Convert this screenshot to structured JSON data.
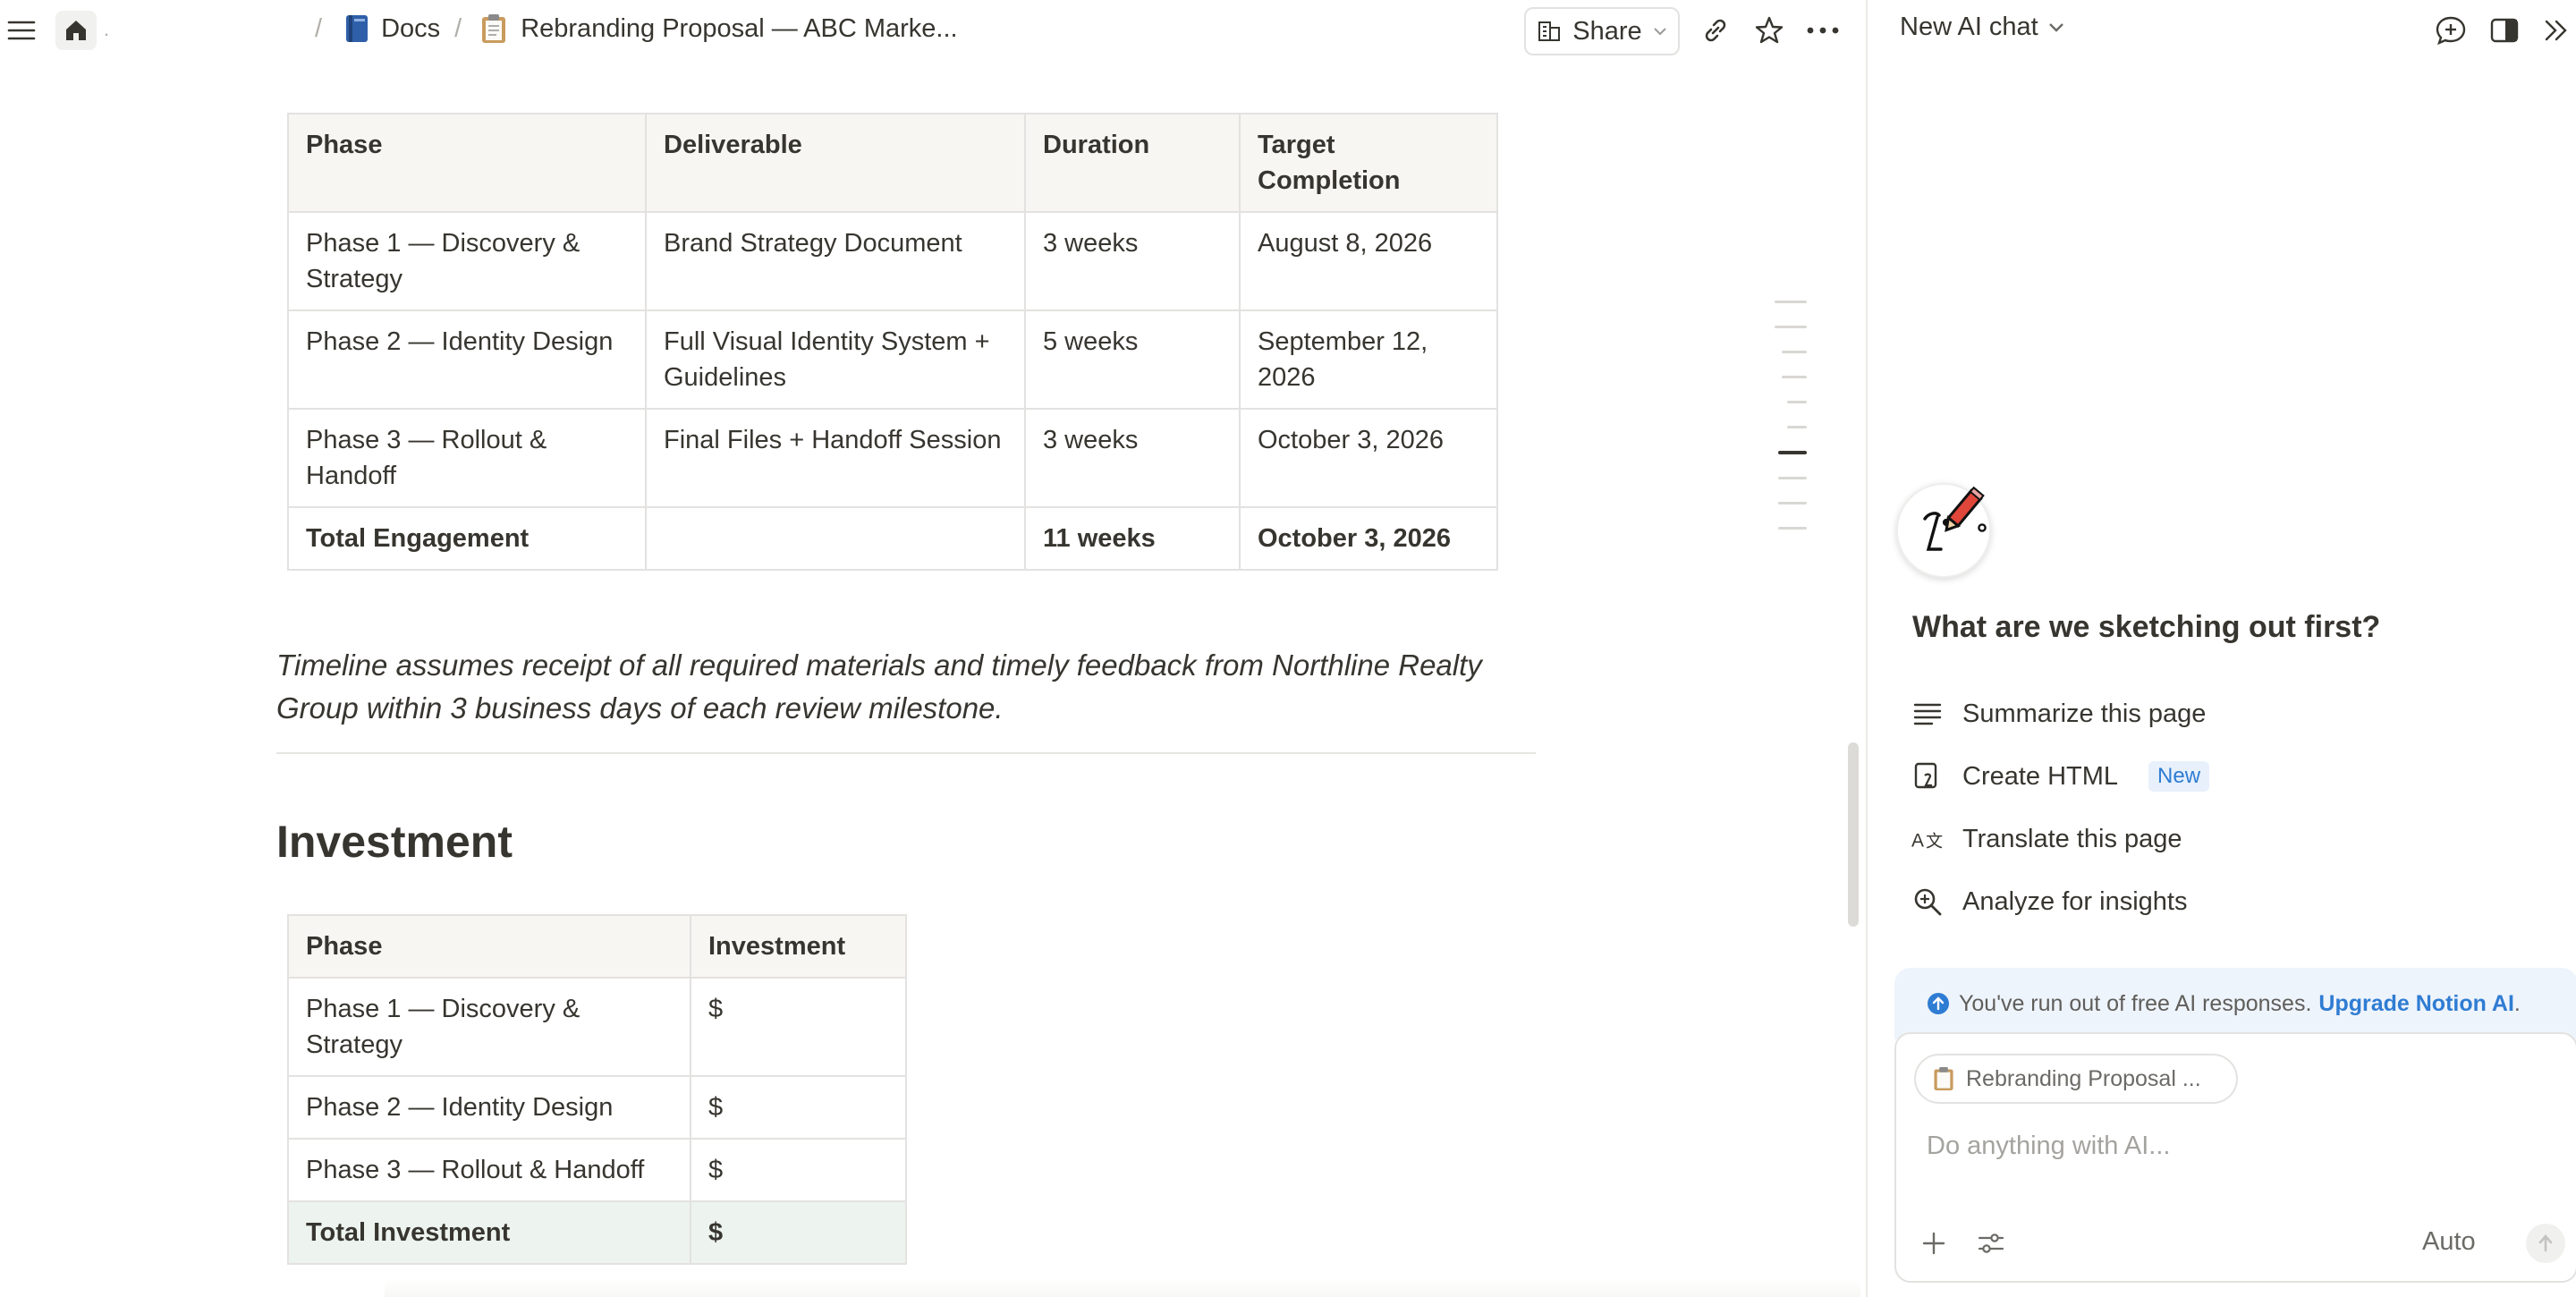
{
  "topbar": {
    "docs_label": "Docs",
    "page_title": "Rebranding Proposal — ABC Marke...",
    "share_label": "Share",
    "separator": "/"
  },
  "timeline": {
    "headers": [
      "Phase",
      "Deliverable",
      "Duration",
      "Target Completion"
    ],
    "rows": [
      [
        "Phase 1 — Discovery & Strategy",
        "Brand Strategy Document",
        "3 weeks",
        "August 8, 2026"
      ],
      [
        "Phase 2 — Identity Design",
        "Full Visual Identity System + Guidelines",
        "5 weeks",
        "September 12, 2026"
      ],
      [
        "Phase 3 — Rollout & Handoff",
        "Final Files + Handoff Session",
        "3 weeks",
        "October 3, 2026"
      ]
    ],
    "total": [
      "Total Engagement",
      "",
      "11 weeks",
      "October 3, 2026"
    ],
    "note": "Timeline assumes receipt of all required materials and timely feedback from Northline Realty Group within 3 business days of each review milestone."
  },
  "investment": {
    "heading": "Investment",
    "headers": [
      "Phase",
      "Investment"
    ],
    "rows": [
      [
        "Phase 1 — Discovery & Strategy",
        "$"
      ],
      [
        "Phase 2 — Identity Design",
        "$"
      ],
      [
        "Phase 3 — Rollout & Handoff",
        "$"
      ]
    ],
    "total": [
      "Total Investment",
      "$"
    ]
  },
  "ai_panel": {
    "title": "New AI chat",
    "question": "What are we sketching out first?",
    "actions": [
      {
        "label": "Summarize this page",
        "icon": "lines-icon"
      },
      {
        "label": "Create HTML",
        "icon": "html-icon",
        "badge": "New"
      },
      {
        "label": "Translate this page",
        "icon": "translate-icon"
      },
      {
        "label": "Analyze for insights",
        "icon": "magnify-plus-icon"
      }
    ],
    "notice_text": "You've run out of free AI responses.",
    "notice_link": "Upgrade Notion AI",
    "notice_period": ".",
    "context_chip": "Rebranding Proposal ...",
    "input_placeholder": "Do anything with AI...",
    "mode": "Auto"
  },
  "colors": {
    "text": "#37352f",
    "link_blue": "#2f7cd3",
    "header_bg": "#f7f6f3",
    "total_row_bg": "#edf3ef"
  }
}
